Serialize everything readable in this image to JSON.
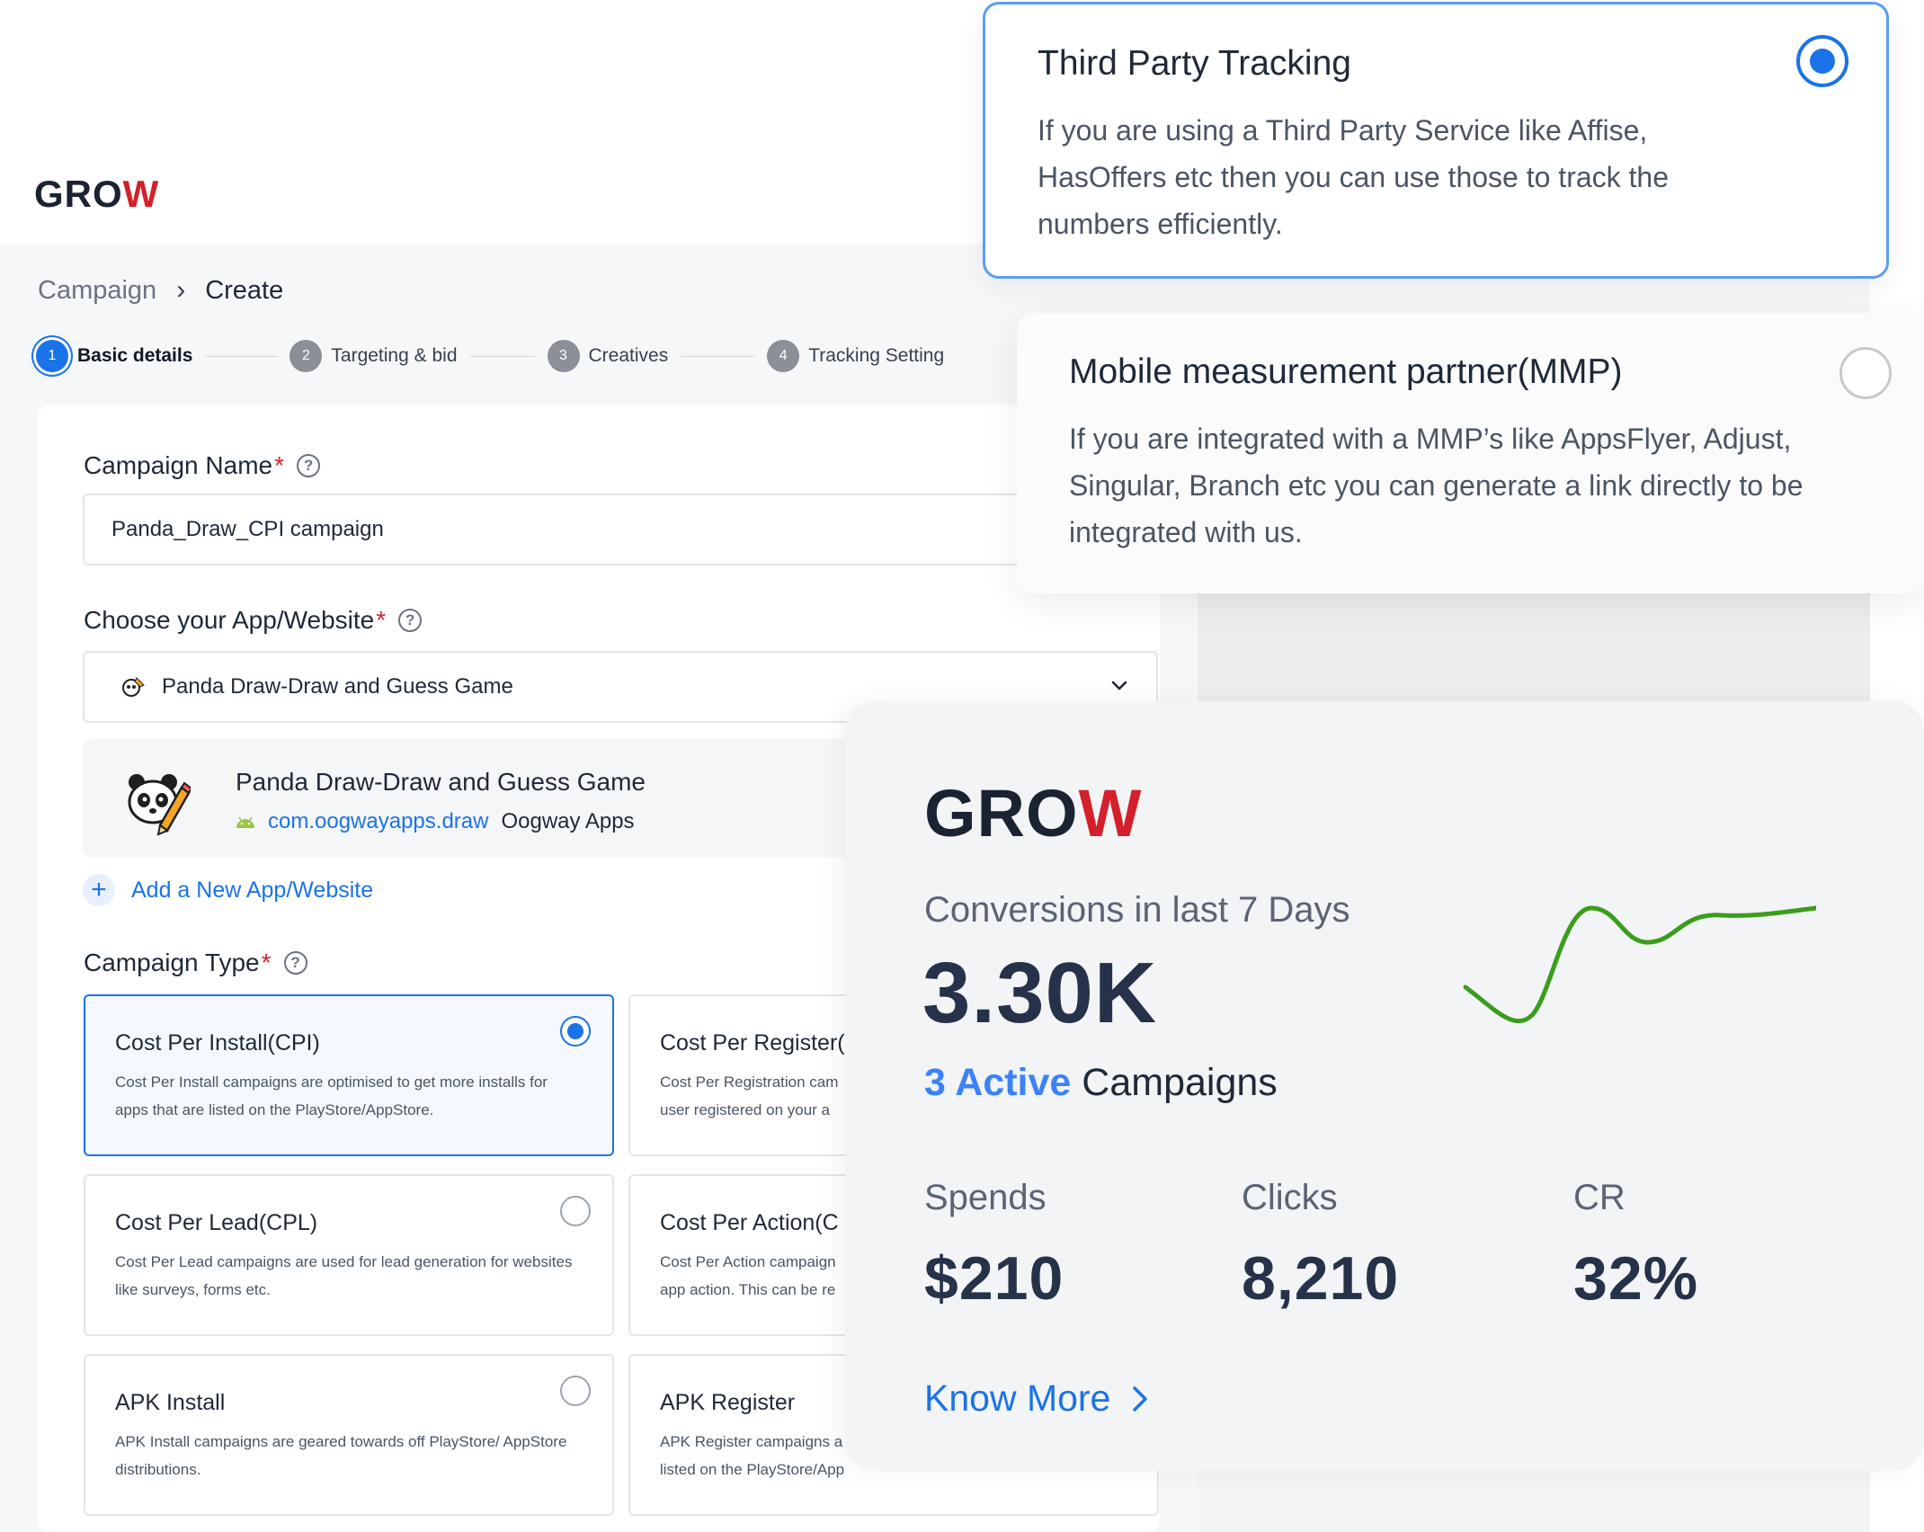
{
  "brand": {
    "logo_main": "GRO",
    "logo_accent": "W"
  },
  "breadcrumb": {
    "root": "Campaign",
    "separator": "›",
    "current": "Create"
  },
  "steps": [
    {
      "num": "1",
      "label": "Basic details",
      "active": true
    },
    {
      "num": "2",
      "label": "Targeting & bid"
    },
    {
      "num": "3",
      "label": "Creatives"
    },
    {
      "num": "4",
      "label": "Tracking Setting"
    }
  ],
  "form": {
    "campaign_name": {
      "label": "Campaign Name",
      "required": "*",
      "value": "Panda_Draw_CPI campaign"
    },
    "app": {
      "label": "Choose your App/Website",
      "required": "*",
      "selected": "Panda Draw-Draw and Guess Game",
      "preview": {
        "title": "Panda Draw-Draw and Guess Game",
        "package": "com.oogwayapps.draw",
        "developer": "Oogway Apps"
      },
      "add_label": "Add a New App/Website",
      "add_icon": "+"
    },
    "campaign_type": {
      "label": "Campaign Type",
      "required": "*",
      "options": [
        {
          "title": "Cost Per Install(CPI)",
          "desc": "Cost Per Install campaigns are optimised to get more installs for apps that are listed on the PlayStore/AppStore.",
          "selected": true
        },
        {
          "title": "Cost Per Register(",
          "desc": "Cost Per Registration cam user registered on your a"
        },
        {
          "title": "Cost Per Lead(CPL)",
          "desc": "Cost Per Lead campaigns are used for lead generation for websites like surveys, forms etc."
        },
        {
          "title": "Cost Per Action(C",
          "desc": "Cost Per Action campaign app action. This can be re"
        },
        {
          "title": "APK Install",
          "desc": "APK Install campaigns are geared towards off PlayStore/ AppStore distributions."
        },
        {
          "title": "APK Register",
          "desc": "APK Register campaigns a listed on the PlayStore/App"
        }
      ]
    }
  },
  "tracking": {
    "third_party": {
      "title": "Third Party Tracking",
      "desc": "If you are using a Third Party Service like Affise, HasOffers etc then you can use those to track the numbers efficiently.",
      "selected": true
    },
    "mmp": {
      "title": "Mobile measurement partner(MMP)",
      "desc": "If you are integrated with a MMP’s like AppsFlyer, Adjust, Singular, Branch etc you can generate a link directly to be integrated with us.",
      "selected": false
    }
  },
  "stats": {
    "conversions_label": "Conversions in last 7 Days",
    "conversions_value": "3.30K",
    "active_count": "3 Active",
    "active_suffix": " Campaigns",
    "spends_label": "Spends",
    "spends_value": "$210",
    "clicks_label": "Clicks",
    "clicks_value": "8,210",
    "cr_label": "CR",
    "cr_value": "32%",
    "know_more": "Know More",
    "sparkline_color": "#3a9d1c"
  },
  "colors": {
    "accent": "#1a73e8",
    "brand_red": "#d4202a",
    "required": "#d4202a"
  }
}
